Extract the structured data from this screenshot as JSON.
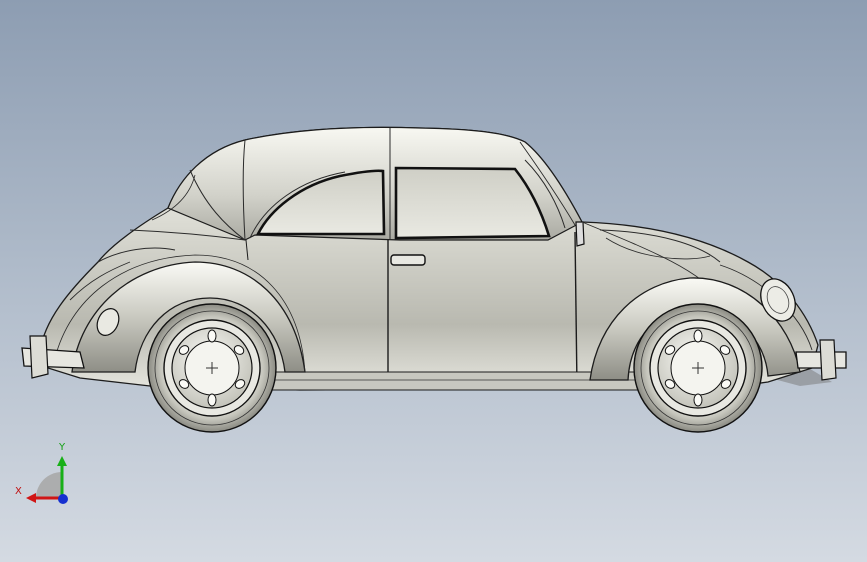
{
  "viewport": {
    "background_top": "#8d9db2",
    "background_bottom": "#d4dae2"
  },
  "model": {
    "icon": "beetle-car-3d-model",
    "view": "side",
    "body_color": "#d9d9d2",
    "edge_color": "#1c1c1c"
  },
  "triad": {
    "x_label": "X",
    "y_label": "Y",
    "x_color": "#d01515",
    "y_color": "#18b018",
    "z_color": "#1530d0"
  }
}
